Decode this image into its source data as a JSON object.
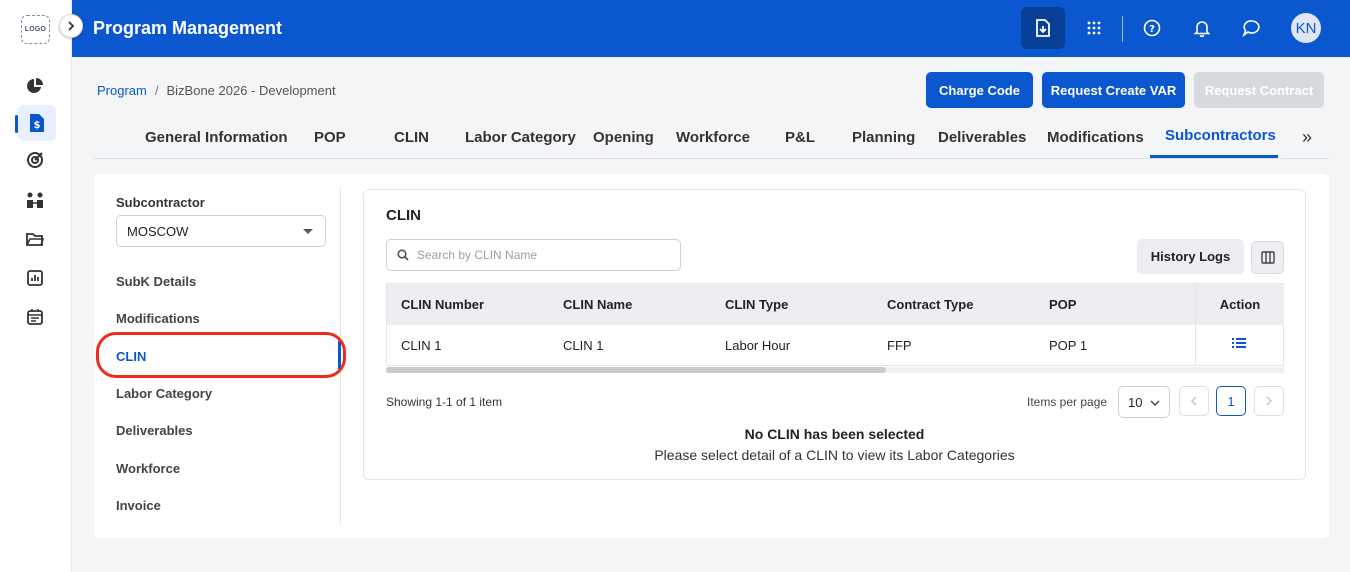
{
  "rail": {
    "logo": "LOGO",
    "icons": [
      "pie-chart-icon",
      "dollar-document-icon",
      "target-icon",
      "people-icon",
      "folder-icon",
      "report-icon",
      "calendar-icon"
    ]
  },
  "topbar": {
    "title": "Program Management",
    "avatar": "KN",
    "icons": [
      "download-document-icon",
      "apps-grid-icon",
      "help-icon",
      "notification-bell-icon",
      "chat-icon"
    ]
  },
  "breadcrumb": {
    "root": "Program",
    "separator": "/",
    "current": "BizBone 2026 - Development"
  },
  "actions": {
    "charge_code": "Charge Code",
    "request_create_var": "Request Create VAR",
    "request_contract": "Request Contract"
  },
  "tabs": [
    "General Information",
    "POP",
    "CLIN",
    "Labor Category",
    "Opening",
    "Workforce",
    "P&L",
    "Planning",
    "Deliverables",
    "Modifications",
    "Subcontractors"
  ],
  "active_tab": "Subcontractors",
  "tabs_more": "»",
  "sidebar": {
    "subcontractor_label": "Subcontractor",
    "subcontractor_value": "MOSCOW",
    "items": [
      "SubK Details",
      "Modifications",
      "CLIN",
      "Labor Category",
      "Deliverables",
      "Workforce",
      "Invoice"
    ],
    "active": "CLIN"
  },
  "clin_panel": {
    "title": "CLIN",
    "search_placeholder": "Search by CLIN Name",
    "history_logs": "History Logs",
    "columns": [
      "CLIN Number",
      "CLIN Name",
      "CLIN Type",
      "Contract Type",
      "POP",
      "Action"
    ],
    "rows": [
      {
        "clin_number": "CLIN 1",
        "clin_name": "CLIN 1",
        "clin_type": "Labor Hour",
        "contract_type": "FFP",
        "pop": "POP 1"
      }
    ],
    "showing": "Showing 1-1 of 1 item",
    "items_per_page_label": "Items per page",
    "items_per_page": "10",
    "current_page": "1",
    "empty_title": "No CLIN has been selected",
    "empty_subtitle": "Please select detail of a CLIN to view its Labor Categories"
  },
  "colors": {
    "primary": "#0b57d0",
    "highlight": "#ef2b1a"
  }
}
